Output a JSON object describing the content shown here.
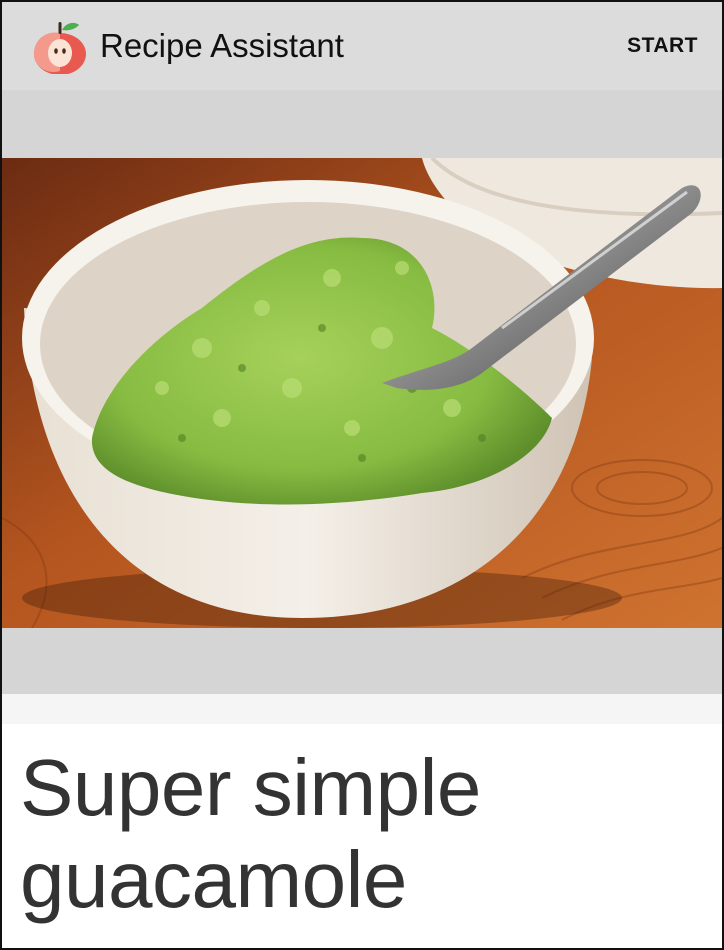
{
  "app_bar": {
    "title": "Recipe Assistant",
    "start_label": "START",
    "icon": "apple-icon",
    "background": "#dcdcdc"
  },
  "hero_image": {
    "icon": "guacamole-bowl-photo",
    "colors": {
      "wood": "#b5541e",
      "bowl": "#f0ebe4",
      "guacamole": "#8fc24a"
    }
  },
  "recipe": {
    "title": "Super simple guacamole"
  }
}
